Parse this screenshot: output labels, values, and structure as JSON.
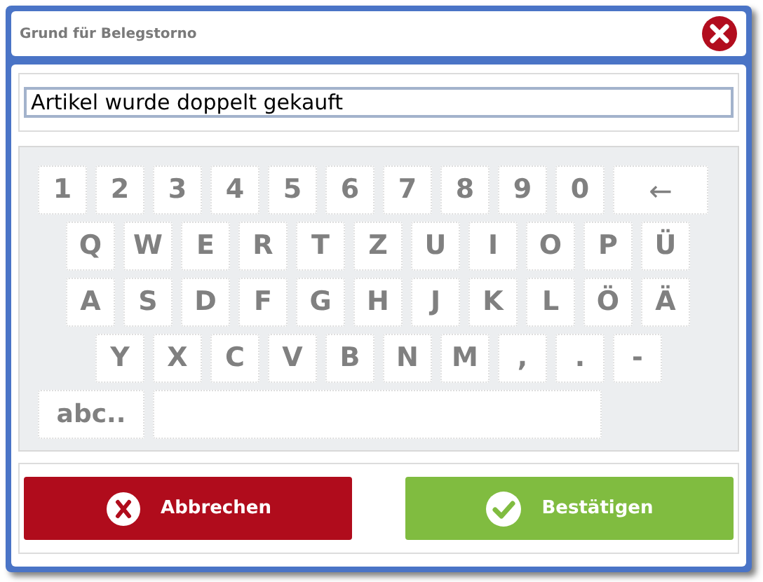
{
  "window": {
    "title": "Grund für Belegstorno"
  },
  "reason_field": {
    "value": "Artikel wurde doppelt gekauft"
  },
  "keyboard": {
    "rows": [
      {
        "keys": [
          {
            "kind": "char",
            "label": "1"
          },
          {
            "kind": "char",
            "label": "2"
          },
          {
            "kind": "char",
            "label": "3"
          },
          {
            "kind": "char",
            "label": "4"
          },
          {
            "kind": "char",
            "label": "5"
          },
          {
            "kind": "char",
            "label": "6"
          },
          {
            "kind": "char",
            "label": "7"
          },
          {
            "kind": "char",
            "label": "8"
          },
          {
            "kind": "char",
            "label": "9"
          },
          {
            "kind": "char",
            "label": "0"
          },
          {
            "kind": "backspace",
            "label": "←"
          }
        ]
      },
      {
        "keys": [
          {
            "kind": "char",
            "label": "Q"
          },
          {
            "kind": "char",
            "label": "W"
          },
          {
            "kind": "char",
            "label": "E"
          },
          {
            "kind": "char",
            "label": "R"
          },
          {
            "kind": "char",
            "label": "T"
          },
          {
            "kind": "char",
            "label": "Z"
          },
          {
            "kind": "char",
            "label": "U"
          },
          {
            "kind": "char",
            "label": "I"
          },
          {
            "kind": "char",
            "label": "O"
          },
          {
            "kind": "char",
            "label": "P"
          },
          {
            "kind": "char",
            "label": "Ü"
          }
        ]
      },
      {
        "keys": [
          {
            "kind": "char",
            "label": "A"
          },
          {
            "kind": "char",
            "label": "S"
          },
          {
            "kind": "char",
            "label": "D"
          },
          {
            "kind": "char",
            "label": "F"
          },
          {
            "kind": "char",
            "label": "G"
          },
          {
            "kind": "char",
            "label": "H"
          },
          {
            "kind": "char",
            "label": "J"
          },
          {
            "kind": "char",
            "label": "K"
          },
          {
            "kind": "char",
            "label": "L"
          },
          {
            "kind": "char",
            "label": "Ö"
          },
          {
            "kind": "char",
            "label": "Ä"
          }
        ]
      },
      {
        "keys": [
          {
            "kind": "char",
            "label": "Y"
          },
          {
            "kind": "char",
            "label": "X"
          },
          {
            "kind": "char",
            "label": "C"
          },
          {
            "kind": "char",
            "label": "V"
          },
          {
            "kind": "char",
            "label": "B"
          },
          {
            "kind": "char",
            "label": "N"
          },
          {
            "kind": "char",
            "label": "M"
          },
          {
            "kind": "char",
            "label": ","
          },
          {
            "kind": "char",
            "label": "."
          },
          {
            "kind": "char",
            "label": "-"
          }
        ]
      },
      {
        "keys": [
          {
            "kind": "mode",
            "label": "abc.."
          },
          {
            "kind": "space"
          }
        ]
      }
    ]
  },
  "buttons": [
    {
      "kind": "cancel",
      "label": "Abbrechen"
    },
    {
      "kind": "confirm",
      "label": "Bestätigen"
    }
  ]
}
